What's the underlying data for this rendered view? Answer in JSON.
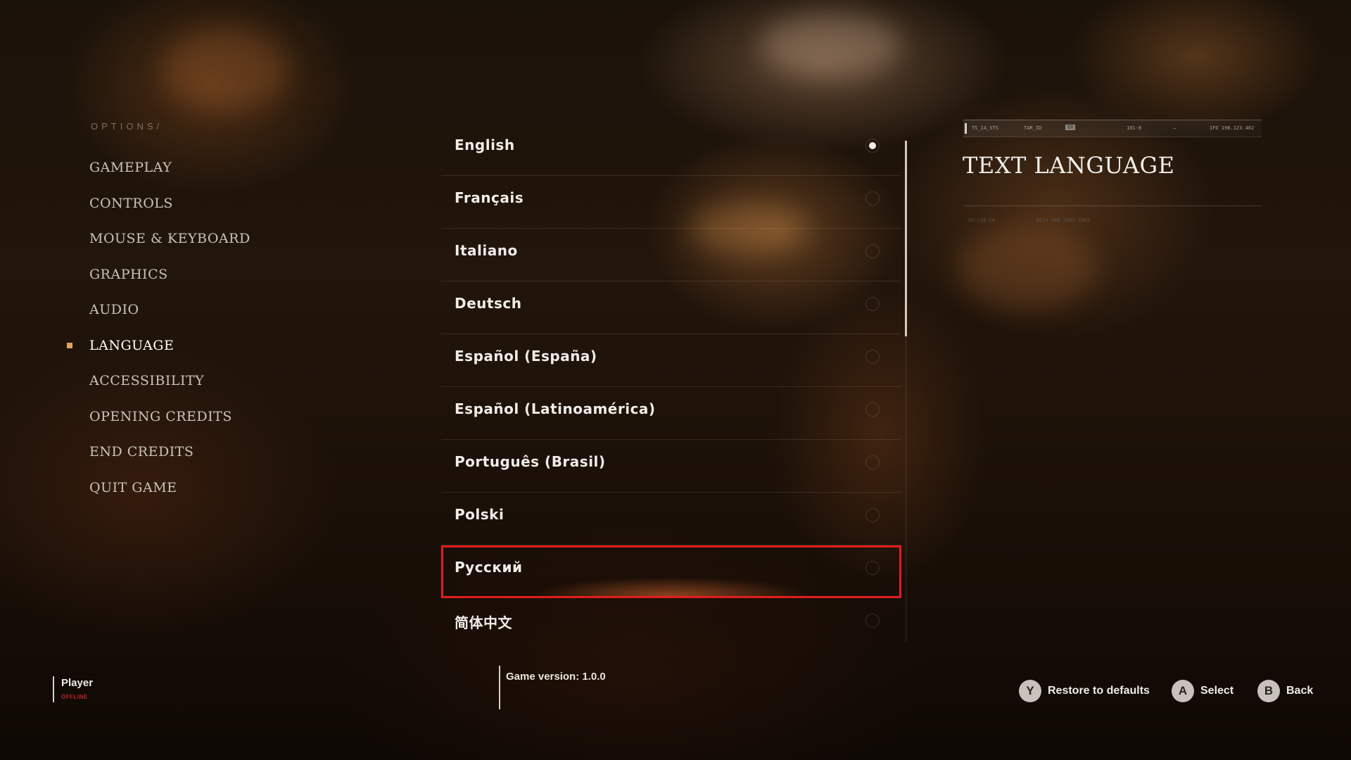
{
  "options": {
    "breadcrumb": "OPTIONS/",
    "menu": [
      {
        "label": "GAMEPLAY"
      },
      {
        "label": "CONTROLS"
      },
      {
        "label": "MOUSE & KEYBOARD"
      },
      {
        "label": "GRAPHICS"
      },
      {
        "label": "AUDIO"
      },
      {
        "label": "LANGUAGE",
        "active": true
      },
      {
        "label": "ACCESSIBILITY"
      },
      {
        "label": "OPENING CREDITS"
      },
      {
        "label": "END CREDITS"
      },
      {
        "label": "QUIT GAME"
      }
    ]
  },
  "languages": [
    {
      "label": "English",
      "selected": true
    },
    {
      "label": "Français"
    },
    {
      "label": "Italiano"
    },
    {
      "label": "Deutsch"
    },
    {
      "label": "Español (España)"
    },
    {
      "label": "Español (Latinoamérica)"
    },
    {
      "label": "Português (Brasil)"
    },
    {
      "label": "Polski"
    },
    {
      "label": "Русский",
      "focused": true
    },
    {
      "label": "简体中文"
    }
  ],
  "info_panel": {
    "title": "TEXT LANGUAGE",
    "header_codes": [
      "TS_IA_STS",
      "TAR_ID",
      "ER",
      "101-8",
      "—",
      "IFO 198.123.402"
    ],
    "meta_codes": [
      "GS-LSE-14",
      "0114 040 2903 1802"
    ]
  },
  "player": {
    "name": "Player",
    "status": "OFFLINE"
  },
  "game_version": "Game version: 1.0.0",
  "prompts": [
    {
      "key": "Y",
      "label": "Restore to defaults"
    },
    {
      "key": "A",
      "label": "Select"
    },
    {
      "key": "B",
      "label": "Back"
    }
  ],
  "colors": {
    "focus_outline": "#e11d1d",
    "active_marker": "#e0a260",
    "offline_status": "#c42424"
  }
}
